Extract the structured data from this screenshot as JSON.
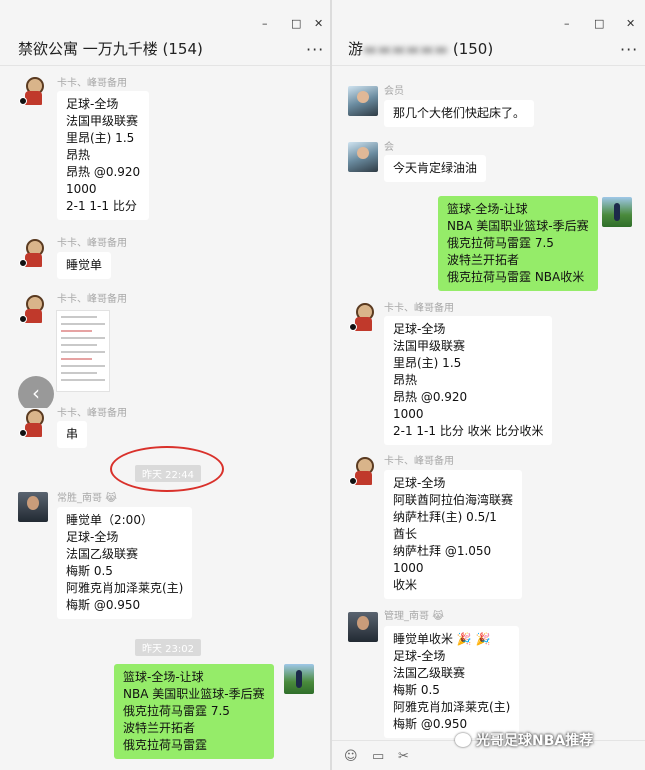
{
  "left_window": {
    "title": "禁欲公寓 一万九千楼 (154)",
    "controls": {
      "minimize": "–",
      "maximize": "□",
      "close": "✕",
      "more": "···"
    },
    "messages": [
      {
        "sender": "卡卡、峰哥备用",
        "lines": [
          "足球-全场",
          "法国甲级联赛",
          "里昂(主) 1.5",
          "昂热",
          "昂热 @0.920",
          "1000",
          "2-1  1-1 比分"
        ]
      },
      {
        "sender": "卡卡、峰哥备用",
        "lines": [
          "睡觉单"
        ]
      },
      {
        "sender": "卡卡、峰哥备用"
      },
      {
        "sender": "卡卡、峰哥备用",
        "lines": [
          "串"
        ]
      },
      {
        "timestamp": "昨天 22:44"
      },
      {
        "sender": "常胜_南哥",
        "emoji": "😹",
        "lines": [
          "睡觉单（2:00）",
          "足球-全场",
          "法国乙级联赛",
          "梅斯 0.5",
          "阿雅克肖加泽莱克(主)",
          "梅斯 @0.950"
        ]
      },
      {
        "timestamp": "昨天 23:02"
      },
      {
        "self": true,
        "lines": [
          "篮球-全场-让球",
          "NBA 美国职业篮球-季后赛",
          "俄克拉荷马雷霆 7.5",
          "波特兰开拓者",
          "俄克拉荷马雷霆"
        ]
      }
    ]
  },
  "right_window": {
    "title": "游",
    "title_suffix": "(150)",
    "controls": {
      "minimize": "–",
      "maximize": "□",
      "close": "✕",
      "more": "···"
    },
    "messages": [
      {
        "sender": "会员",
        "lines": [
          "那几个大佬们快起床了。"
        ]
      },
      {
        "sender": "会",
        "lines": [
          "今天肯定绿油油"
        ]
      },
      {
        "self": true,
        "lines": [
          "篮球-全场-让球",
          "NBA 美国职业篮球-季后赛",
          "俄克拉荷马雷霆 7.5",
          "波特兰开拓者",
          "俄克拉荷马雷霆    NBA收米"
        ]
      },
      {
        "sender": "卡卡、峰哥备用",
        "lines": [
          "足球-全场",
          "法国甲级联赛",
          "里昂(主) 1.5",
          "昂热",
          "昂热 @0.920",
          "1000",
          "2-1  1-1 比分   收米   比分收米"
        ]
      },
      {
        "sender": "卡卡、峰哥备用",
        "lines": [
          "足球-全场",
          "阿联酋阿拉伯海湾联赛",
          "纳萨杜拜(主) 0.5/1",
          "酋长",
          "纳萨杜拜 @1.050",
          "1000",
          "收米"
        ]
      },
      {
        "sender": "管理_南哥",
        "emoji": "😹",
        "lines": [
          "睡觉单收米 🎉 🎉",
          "足球-全场",
          "法国乙级联赛",
          "梅斯 0.5",
          "阿雅克肖加泽莱克(主)",
          "梅斯 @0.950"
        ]
      }
    ],
    "input_icons": {
      "emoji": "☺",
      "folder": "▭",
      "scissors": "✂"
    }
  },
  "watermark": "光哥足球NBA推荐",
  "colors": {
    "green_bubble": "#95ec69",
    "background": "#f5f5f5",
    "highlight_circle": "#d9312b"
  }
}
